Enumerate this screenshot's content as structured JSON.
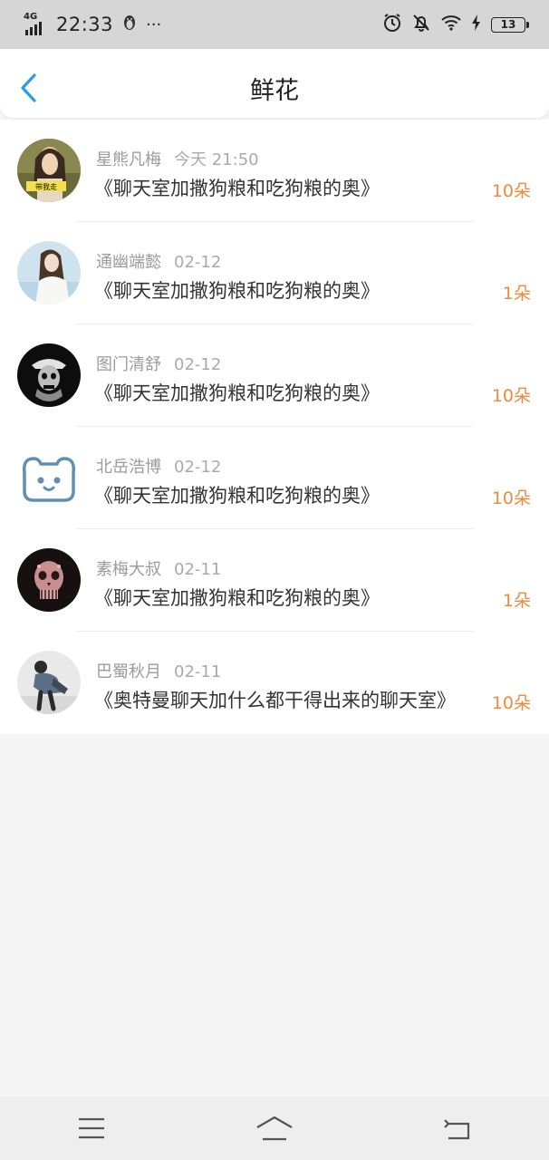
{
  "status_bar": {
    "network": "4G",
    "time": "22:33",
    "qq_icon": "penguin-icon",
    "more": "···",
    "battery": "13"
  },
  "header": {
    "back_icon": "chevron-left-icon",
    "title": "鲜花"
  },
  "accent_color": "#ee8a3c",
  "rows": [
    {
      "user": "星熊凡梅",
      "date": "今天 21:50",
      "title": "《聊天室加撒狗粮和吃狗粮的奥》",
      "count": "10朵",
      "avatar_text": "带我走"
    },
    {
      "user": "通幽端懿",
      "date": "02-12",
      "title": "《聊天室加撒狗粮和吃狗粮的奥》",
      "count": "1朵"
    },
    {
      "user": "图门清舒",
      "date": "02-12",
      "title": "《聊天室加撒狗粮和吃狗粮的奥》",
      "count": "10朵"
    },
    {
      "user": "北岳浩博",
      "date": "02-12",
      "title": "《聊天室加撒狗粮和吃狗粮的奥》",
      "count": "10朵"
    },
    {
      "user": "素梅大叔",
      "date": "02-11",
      "title": "《聊天室加撒狗粮和吃狗粮的奥》",
      "count": "1朵"
    },
    {
      "user": "巴蜀秋月",
      "date": "02-11",
      "title": "《奥特曼聊天加什么都干得出来的聊天室》",
      "count": "10朵"
    }
  ],
  "bottom_nav": {
    "menu_icon": "menu-icon",
    "home_icon": "home-icon",
    "back_icon": "back-arrow-icon"
  }
}
